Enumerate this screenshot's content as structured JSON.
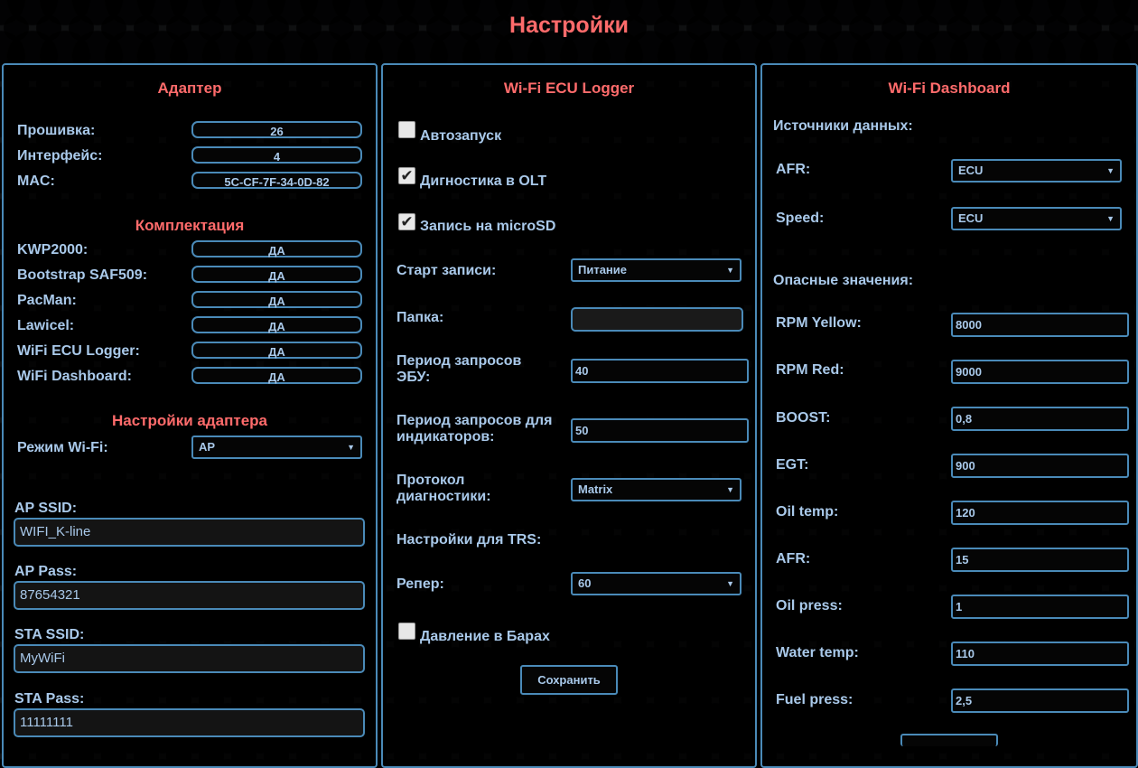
{
  "page_title": "Настройки",
  "adapter": {
    "title": "Адаптер",
    "info": [
      {
        "label": "Прошивка:",
        "value": "26"
      },
      {
        "label": "Интерфейс:",
        "value": "4"
      },
      {
        "label": "MAC:",
        "value": "5C-CF-7F-34-0D-82"
      }
    ],
    "kit_title": "Комплектация",
    "kit": [
      {
        "label": "KWP2000:",
        "value": "ДА"
      },
      {
        "label": "Bootstrap SAF509:",
        "value": "ДА"
      },
      {
        "label": "PacMan:",
        "value": "ДА"
      },
      {
        "label": "Lawicel:",
        "value": "ДА"
      },
      {
        "label": "WiFi ECU Logger:",
        "value": "ДА"
      },
      {
        "label": "WiFi Dashboard:",
        "value": "ДА"
      }
    ],
    "settings_title": "Настройки адаптера",
    "wifi_mode_label": "Режим Wi-Fi:",
    "wifi_mode_value": "AP",
    "fields": [
      {
        "label": "AP SSID:",
        "value": "WIFI_K-line"
      },
      {
        "label": "AP Pass:",
        "value": "87654321"
      },
      {
        "label": "STA SSID:",
        "value": "MyWiFi"
      },
      {
        "label": "STA Pass:",
        "value": "11111111"
      }
    ]
  },
  "logger": {
    "title": "Wi-Fi ECU Logger",
    "autostart_label": "Автозапуск",
    "autostart_checked": false,
    "olt_label": "Дигностика в OLT",
    "olt_checked": true,
    "sd_label": "Запись на microSD",
    "sd_checked": true,
    "rec_start_label": "Старт записи:",
    "rec_start_value": "Питание",
    "folder_label": "Папка:",
    "folder_value": "",
    "ecu_period_label": "Период запросов ЭБУ:",
    "ecu_period_value": "40",
    "ind_period_label": "Период запросов для индикаторов:",
    "ind_period_value": "50",
    "protocol_label": "Протокол диагностики:",
    "protocol_value": "Matrix",
    "trs_label": "Настройки для TRS:",
    "reper_label": "Репер:",
    "reper_value": "60",
    "bar_label": "Давление в Барах",
    "bar_checked": false,
    "save_label": "Сохранить"
  },
  "dashboard": {
    "title": "Wi-Fi Dashboard",
    "sources_title": "Источники данных:",
    "sources": [
      {
        "label": "AFR:",
        "value": "ECU"
      },
      {
        "label": "Speed:",
        "value": "ECU"
      }
    ],
    "danger_title": "Опасные значения:",
    "danger": [
      {
        "label": "RPM Yellow:",
        "value": "8000"
      },
      {
        "label": "RPM Red:",
        "value": "9000"
      },
      {
        "label": "BOOST:",
        "value": "0,8"
      },
      {
        "label": "EGT:",
        "value": "900"
      },
      {
        "label": "Oil temp:",
        "value": "120"
      },
      {
        "label": "AFR:",
        "value": "15"
      },
      {
        "label": "Oil press:",
        "value": "1"
      },
      {
        "label": "Water temp:",
        "value": "110"
      },
      {
        "label": "Fuel press:",
        "value": "2,5"
      }
    ]
  }
}
